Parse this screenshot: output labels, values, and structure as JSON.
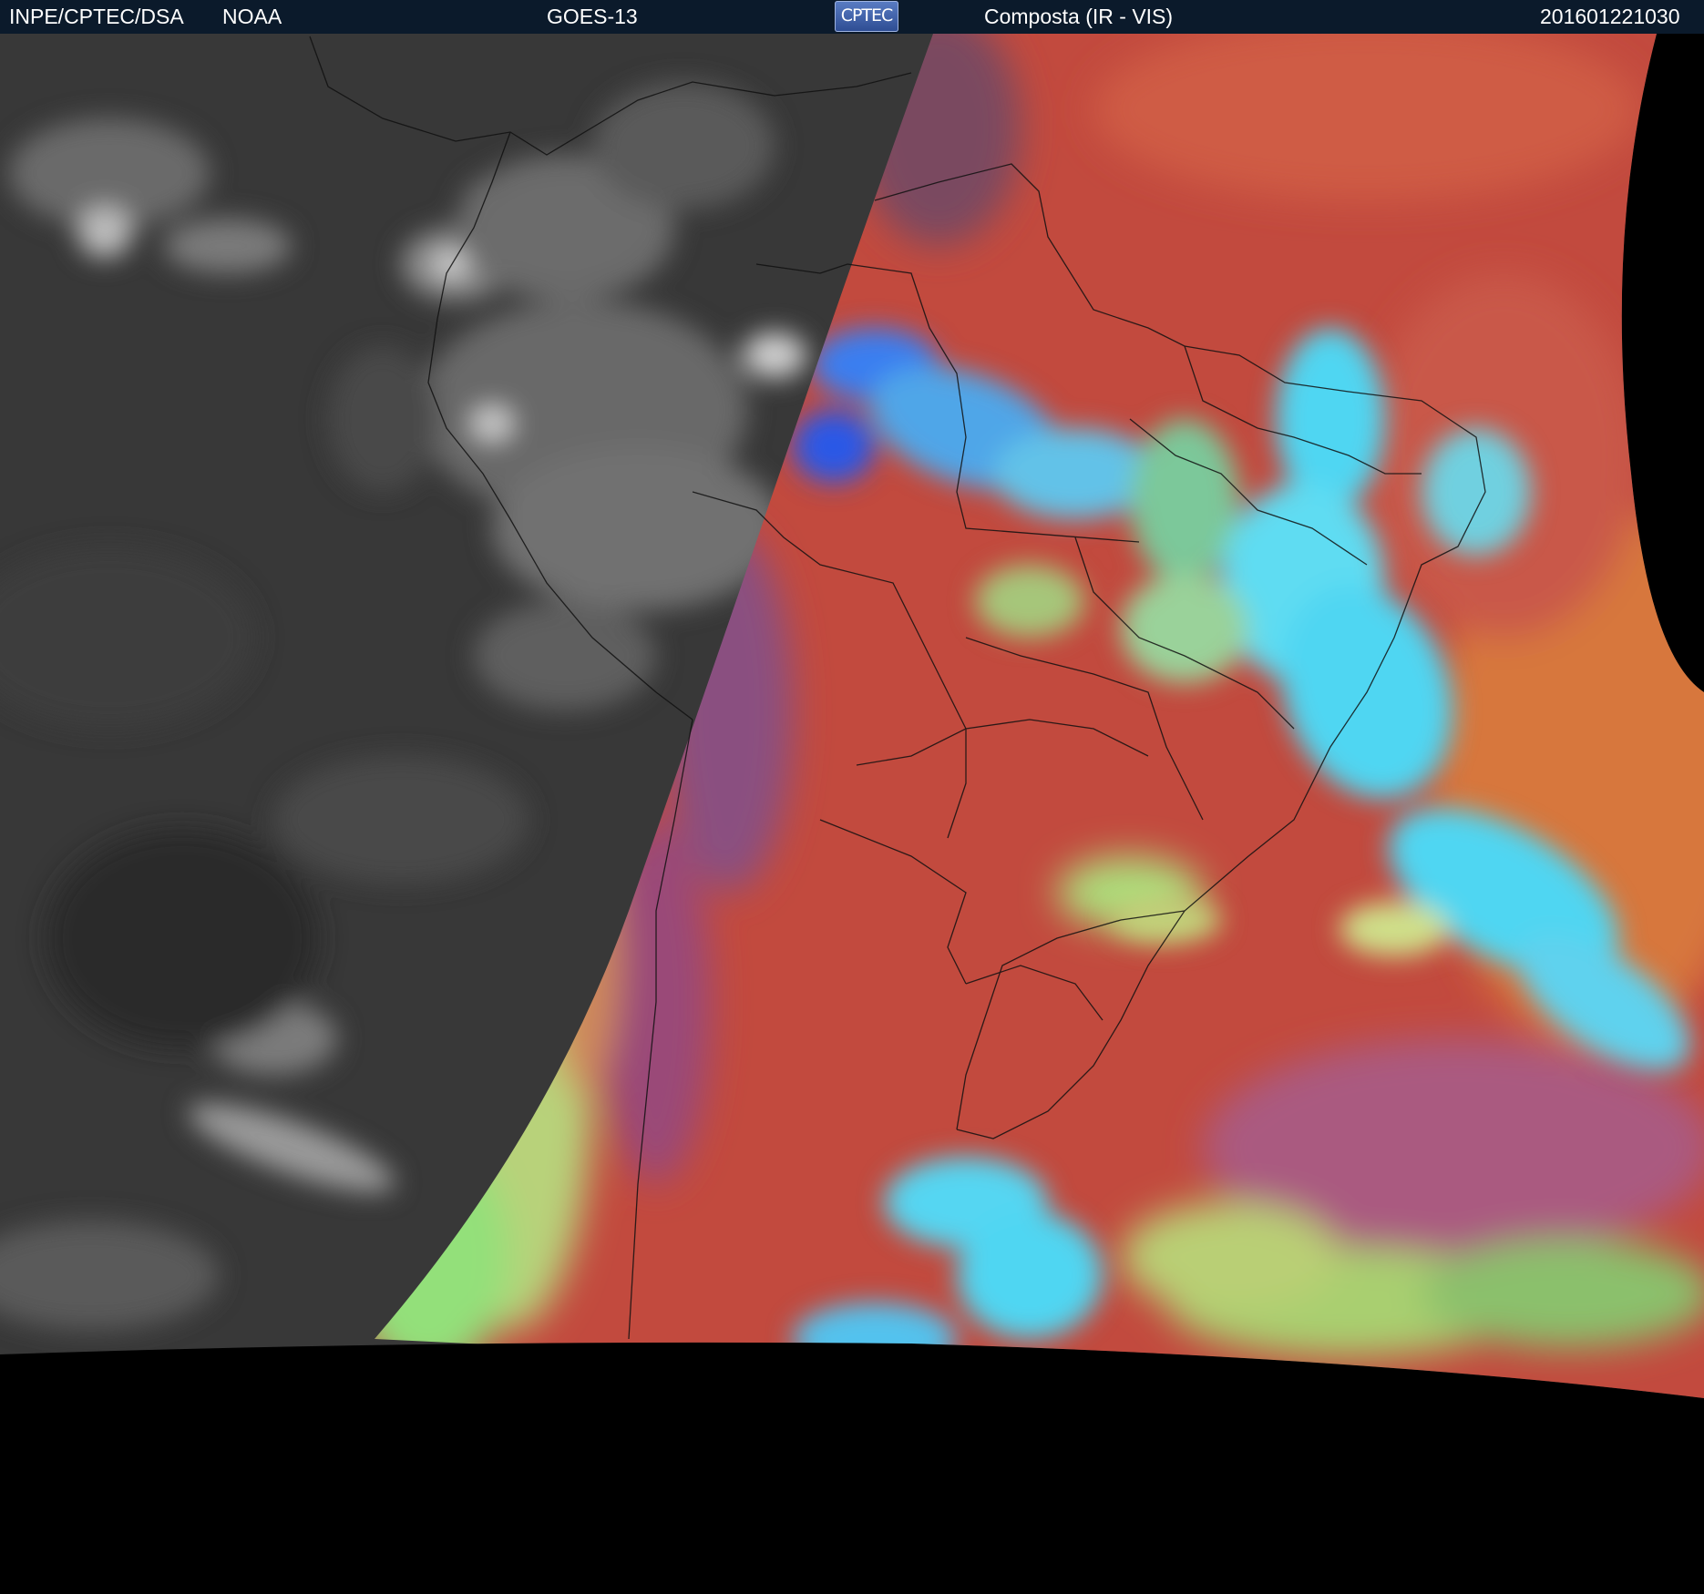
{
  "header": {
    "agency": "INPE/CPTEC/DSA",
    "source": "NOAA",
    "satellite": "GOES-13",
    "logo_text": "CPTEC",
    "product": "Composta (IR - VIS)",
    "timestamp": "201601221030"
  },
  "colors": {
    "header_bg": "#0b1a2b",
    "ir_gray": "#3a3a3a",
    "land_red": "#b8443c",
    "cloud_cyan": "#4fd6f2",
    "cold_cloud_blue": "#2a64e8",
    "limb_green": "#8ee07a",
    "ocean_orange": "#d4703a",
    "space": "#000000"
  }
}
